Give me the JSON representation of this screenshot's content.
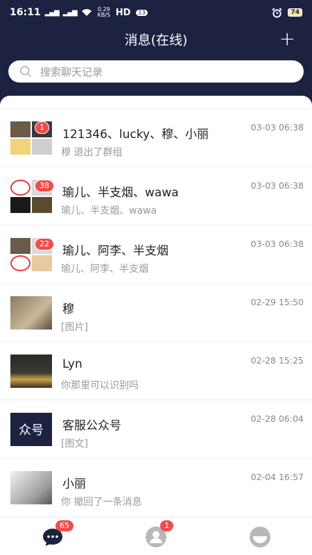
{
  "status_bar": {
    "time": "16:11",
    "network": "0.29 KB/S",
    "hd": "HD",
    "notif_count": "13",
    "battery": "74"
  },
  "header": {
    "title": "消息(在线)",
    "add_label": "+"
  },
  "search": {
    "placeholder": "搜索聊天记录"
  },
  "conversations": [
    {
      "name": "121346、lucky、穆、小丽",
      "preview": "穆 退出了群组",
      "time": "03-03 06:38",
      "badge": "1"
    },
    {
      "name": "瑜儿、半支烟、wawa",
      "preview": "瑜儿、半支烟、wawa",
      "time": "03-03 06:38",
      "badge": "38"
    },
    {
      "name": "瑜儿、阿李、半支烟",
      "preview": "瑜儿、阿李、半支烟",
      "time": "03-03 06:38",
      "badge": "22"
    },
    {
      "name": "穆",
      "preview": "[图片]",
      "time": "02-29 15:50",
      "badge": ""
    },
    {
      "name": "Lyn",
      "preview": "你那里可以识别吗",
      "time": "02-28 15:25",
      "badge": ""
    },
    {
      "name": "客服公众号",
      "preview": "[图文]",
      "time": "02-28 06:04",
      "badge": "",
      "avatar_text": "众号"
    },
    {
      "name": "小丽",
      "preview": "你 撤回了一条消息",
      "time": "02-04 16:57",
      "badge": ""
    }
  ],
  "tabbar": {
    "messages_badge": "65",
    "contacts_badge": "1"
  },
  "colors": {
    "header_bg": "#1c2240",
    "badge": "#f24b4b",
    "tab_active": "#1c2240",
    "tab_inactive": "#b8b8b8"
  }
}
